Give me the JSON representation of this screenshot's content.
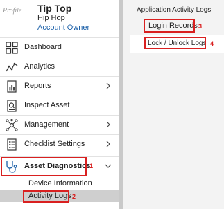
{
  "profile": {
    "logo_text": "Profile",
    "name": "Tip Top",
    "subtitle": "Hip Hop",
    "role": "Account Owner"
  },
  "nav": {
    "items": [
      {
        "label": "Dashboard",
        "icon": "dashboard-grid-icon"
      },
      {
        "label": "Analytics",
        "icon": "analytics-line-icon"
      },
      {
        "label": "Reports",
        "icon": "reports-icon",
        "expandable": true
      },
      {
        "label": "Inspect Asset",
        "icon": "inspect-asset-icon"
      },
      {
        "label": "Management",
        "icon": "management-network-icon",
        "expandable": true
      },
      {
        "label": "Checklist Settings",
        "icon": "checklist-icon",
        "expandable": true
      },
      {
        "label": "Asset Diagnostics",
        "icon": "stethoscope-icon",
        "expanded": true,
        "badge": "1"
      }
    ],
    "sub_items": [
      {
        "label": "Device Information"
      },
      {
        "label": "Activity Logs",
        "active": true,
        "badge": "2"
      }
    ]
  },
  "right_panel": {
    "title": "Application Activity Logs",
    "tabs": [
      {
        "label": "Login Records",
        "badge": "3"
      },
      {
        "label": "Lock / Unlock Logs",
        "badge": "4"
      }
    ]
  },
  "colors": {
    "highlight": "#d92020",
    "link": "#1a5fa8",
    "active_bg": "#cfcfcf"
  }
}
